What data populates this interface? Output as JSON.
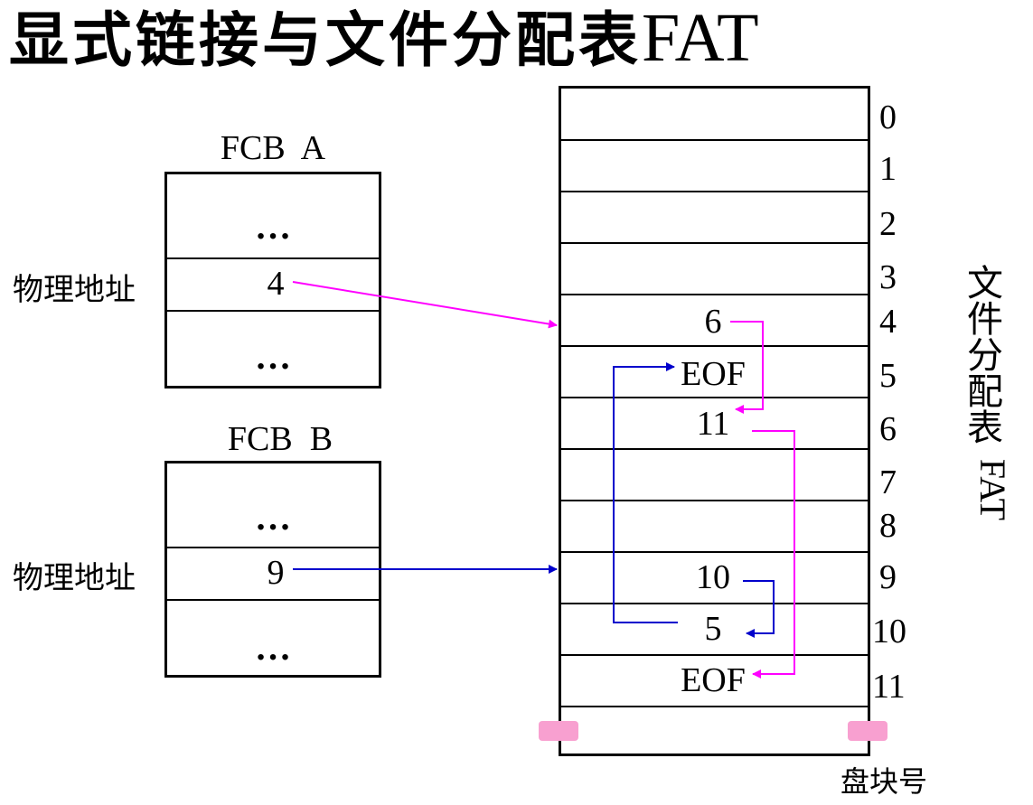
{
  "title": {
    "main": "显式链接与文件分配表",
    "suffix": "FAT"
  },
  "fcb_a": {
    "label": "FCB  A",
    "top_dots": "…",
    "address": "4",
    "bottom_dots": "…",
    "address_label": "物理地址"
  },
  "fcb_b": {
    "label": "FCB  B",
    "top_dots": "…",
    "address": "9",
    "bottom_dots": "…",
    "address_label": "物理地址"
  },
  "fat": {
    "vertical_label": "文件分配表",
    "vertical_label_suffix": "FAT",
    "block_numbers": [
      "0",
      "1",
      "2",
      "3",
      "4",
      "5",
      "6",
      "7",
      "8",
      "9",
      "10",
      "11"
    ],
    "entries": [
      {
        "block": 4,
        "value": "6"
      },
      {
        "block": 5,
        "value": "EOF"
      },
      {
        "block": 6,
        "value": "11"
      },
      {
        "block": 9,
        "value": "10"
      },
      {
        "block": 10,
        "value": "5"
      },
      {
        "block": 11,
        "value": "EOF"
      }
    ],
    "block_caption": "盘块号"
  },
  "colors": {
    "chain_a": "#ff00ff",
    "chain_b": "#0000cc",
    "tear": "#f8a0d0"
  }
}
